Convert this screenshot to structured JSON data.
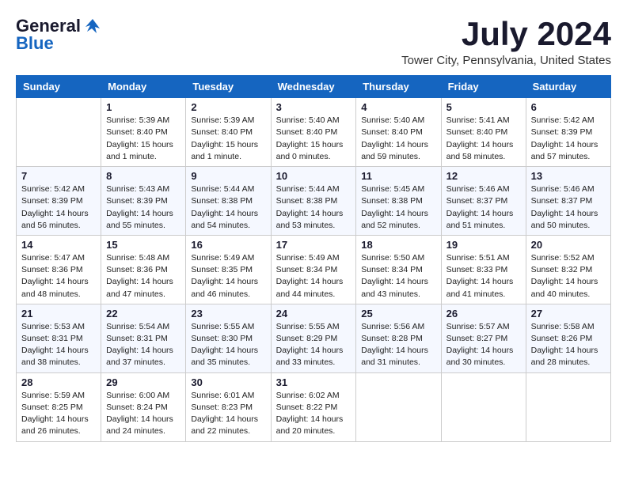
{
  "header": {
    "logo_general": "General",
    "logo_blue": "Blue",
    "month_title": "July 2024",
    "location": "Tower City, Pennsylvania, United States"
  },
  "calendar": {
    "days_of_week": [
      "Sunday",
      "Monday",
      "Tuesday",
      "Wednesday",
      "Thursday",
      "Friday",
      "Saturday"
    ],
    "weeks": [
      [
        {
          "day": "",
          "info": ""
        },
        {
          "day": "1",
          "info": "Sunrise: 5:39 AM\nSunset: 8:40 PM\nDaylight: 15 hours\nand 1 minute."
        },
        {
          "day": "2",
          "info": "Sunrise: 5:39 AM\nSunset: 8:40 PM\nDaylight: 15 hours\nand 1 minute."
        },
        {
          "day": "3",
          "info": "Sunrise: 5:40 AM\nSunset: 8:40 PM\nDaylight: 15 hours\nand 0 minutes."
        },
        {
          "day": "4",
          "info": "Sunrise: 5:40 AM\nSunset: 8:40 PM\nDaylight: 14 hours\nand 59 minutes."
        },
        {
          "day": "5",
          "info": "Sunrise: 5:41 AM\nSunset: 8:40 PM\nDaylight: 14 hours\nand 58 minutes."
        },
        {
          "day": "6",
          "info": "Sunrise: 5:42 AM\nSunset: 8:39 PM\nDaylight: 14 hours\nand 57 minutes."
        }
      ],
      [
        {
          "day": "7",
          "info": "Sunrise: 5:42 AM\nSunset: 8:39 PM\nDaylight: 14 hours\nand 56 minutes."
        },
        {
          "day": "8",
          "info": "Sunrise: 5:43 AM\nSunset: 8:39 PM\nDaylight: 14 hours\nand 55 minutes."
        },
        {
          "day": "9",
          "info": "Sunrise: 5:44 AM\nSunset: 8:38 PM\nDaylight: 14 hours\nand 54 minutes."
        },
        {
          "day": "10",
          "info": "Sunrise: 5:44 AM\nSunset: 8:38 PM\nDaylight: 14 hours\nand 53 minutes."
        },
        {
          "day": "11",
          "info": "Sunrise: 5:45 AM\nSunset: 8:38 PM\nDaylight: 14 hours\nand 52 minutes."
        },
        {
          "day": "12",
          "info": "Sunrise: 5:46 AM\nSunset: 8:37 PM\nDaylight: 14 hours\nand 51 minutes."
        },
        {
          "day": "13",
          "info": "Sunrise: 5:46 AM\nSunset: 8:37 PM\nDaylight: 14 hours\nand 50 minutes."
        }
      ],
      [
        {
          "day": "14",
          "info": "Sunrise: 5:47 AM\nSunset: 8:36 PM\nDaylight: 14 hours\nand 48 minutes."
        },
        {
          "day": "15",
          "info": "Sunrise: 5:48 AM\nSunset: 8:36 PM\nDaylight: 14 hours\nand 47 minutes."
        },
        {
          "day": "16",
          "info": "Sunrise: 5:49 AM\nSunset: 8:35 PM\nDaylight: 14 hours\nand 46 minutes."
        },
        {
          "day": "17",
          "info": "Sunrise: 5:49 AM\nSunset: 8:34 PM\nDaylight: 14 hours\nand 44 minutes."
        },
        {
          "day": "18",
          "info": "Sunrise: 5:50 AM\nSunset: 8:34 PM\nDaylight: 14 hours\nand 43 minutes."
        },
        {
          "day": "19",
          "info": "Sunrise: 5:51 AM\nSunset: 8:33 PM\nDaylight: 14 hours\nand 41 minutes."
        },
        {
          "day": "20",
          "info": "Sunrise: 5:52 AM\nSunset: 8:32 PM\nDaylight: 14 hours\nand 40 minutes."
        }
      ],
      [
        {
          "day": "21",
          "info": "Sunrise: 5:53 AM\nSunset: 8:31 PM\nDaylight: 14 hours\nand 38 minutes."
        },
        {
          "day": "22",
          "info": "Sunrise: 5:54 AM\nSunset: 8:31 PM\nDaylight: 14 hours\nand 37 minutes."
        },
        {
          "day": "23",
          "info": "Sunrise: 5:55 AM\nSunset: 8:30 PM\nDaylight: 14 hours\nand 35 minutes."
        },
        {
          "day": "24",
          "info": "Sunrise: 5:55 AM\nSunset: 8:29 PM\nDaylight: 14 hours\nand 33 minutes."
        },
        {
          "day": "25",
          "info": "Sunrise: 5:56 AM\nSunset: 8:28 PM\nDaylight: 14 hours\nand 31 minutes."
        },
        {
          "day": "26",
          "info": "Sunrise: 5:57 AM\nSunset: 8:27 PM\nDaylight: 14 hours\nand 30 minutes."
        },
        {
          "day": "27",
          "info": "Sunrise: 5:58 AM\nSunset: 8:26 PM\nDaylight: 14 hours\nand 28 minutes."
        }
      ],
      [
        {
          "day": "28",
          "info": "Sunrise: 5:59 AM\nSunset: 8:25 PM\nDaylight: 14 hours\nand 26 minutes."
        },
        {
          "day": "29",
          "info": "Sunrise: 6:00 AM\nSunset: 8:24 PM\nDaylight: 14 hours\nand 24 minutes."
        },
        {
          "day": "30",
          "info": "Sunrise: 6:01 AM\nSunset: 8:23 PM\nDaylight: 14 hours\nand 22 minutes."
        },
        {
          "day": "31",
          "info": "Sunrise: 6:02 AM\nSunset: 8:22 PM\nDaylight: 14 hours\nand 20 minutes."
        },
        {
          "day": "",
          "info": ""
        },
        {
          "day": "",
          "info": ""
        },
        {
          "day": "",
          "info": ""
        }
      ]
    ]
  }
}
